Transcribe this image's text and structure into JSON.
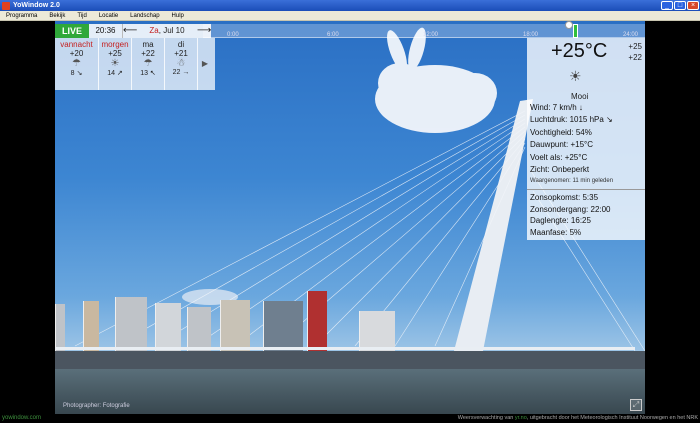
{
  "window": {
    "title": "YoWindow 2.0"
  },
  "menu": {
    "items": [
      "Programma",
      "Bekijk",
      "Tijd",
      "Locatie",
      "Landschap",
      "Hulp"
    ]
  },
  "timeline": {
    "ticks": [
      "0:00",
      "6:00",
      "12:00",
      "18:00",
      "24:00"
    ]
  },
  "toolbar": {
    "live": "LIVE",
    "time": "20:36",
    "date_day": "Za",
    "date_rest": ", Jul 10",
    "prev": "⟵",
    "next": "⟶"
  },
  "forecast": {
    "days": [
      {
        "name": "vannacht",
        "temp": "+20",
        "icon": "☂",
        "wind": "8 ↘",
        "highlight": true
      },
      {
        "name": "morgen",
        "temp": "+25",
        "icon": "☀",
        "wind": "14 ↗",
        "highlight": true
      },
      {
        "name": "ma",
        "temp": "+22",
        "icon": "☂",
        "wind": "13 ↖",
        "highlight": false
      },
      {
        "name": "di",
        "temp": "+21",
        "icon": "☃",
        "wind": "22 →",
        "highlight": false
      }
    ],
    "next_arrow": "▶"
  },
  "current": {
    "temp": "+25°C",
    "high": "+25",
    "low": "+22",
    "icon": "☀",
    "condition": "Mooi",
    "wind": "Wind:  7 km/h  ↓",
    "pressure": "Luchtdruk:  1015 hPa  ↘",
    "humidity": "Vochtigheid:  54%",
    "dewpoint": "Dauwpunt:  +15°C",
    "feels": "Voelt als:  +25°C",
    "visibility": "Zicht:  Onbeperkt",
    "observed": "Waargenomen:  11 min geleden",
    "sunrise": "Zonsopkomst:  5:35",
    "sunset": "Zonsondergang:  22:00",
    "daylength": "Daglengte:  16:25",
    "moon": "Maanfase:  5%"
  },
  "status": {
    "site": "yowindow.com",
    "credit_pre": "Weersverwachting van ",
    "credit_link": "yr.no",
    "credit_post": ", uitgebracht door het Meteorologisch Instituut Noorwegen en het NRK",
    "photo": "Photographer: Fotografie",
    "fullscreen": "⤢"
  },
  "colors": {
    "live": "#2fa83a",
    "accent_red": "#c42020",
    "link": "#3d8f3d"
  }
}
